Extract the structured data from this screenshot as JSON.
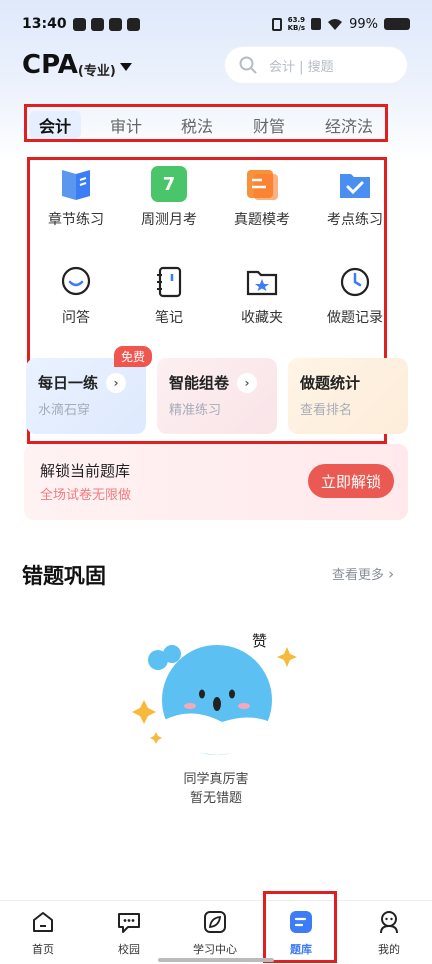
{
  "status_bar": {
    "time": "13:40",
    "net_speed_value": "63.9",
    "net_speed_unit": "KB/s",
    "battery": "99%"
  },
  "header": {
    "exam": "CPA",
    "exam_sub": "(专业)",
    "search_placeholder": "会计 | 搜题"
  },
  "subject_tabs": [
    {
      "label": "会计",
      "active": true
    },
    {
      "label": "审计",
      "active": false
    },
    {
      "label": "税法",
      "active": false
    },
    {
      "label": "财管",
      "active": false
    },
    {
      "label": "经济法",
      "active": false
    }
  ],
  "grid_row1": [
    {
      "label": "章节练习",
      "icon": "book-icon"
    },
    {
      "label": "周测月考",
      "icon": "calendar-icon",
      "icon_text": "7"
    },
    {
      "label": "真题模考",
      "icon": "exam-paper-icon"
    },
    {
      "label": "考点练习",
      "icon": "folder-check-icon"
    }
  ],
  "grid_row2": [
    {
      "label": "问答",
      "icon": "chat-bubble-icon"
    },
    {
      "label": "笔记",
      "icon": "notebook-icon"
    },
    {
      "label": "收藏夹",
      "icon": "star-folder-icon"
    },
    {
      "label": "做题记录",
      "icon": "clock-icon"
    }
  ],
  "cards": [
    {
      "title": "每日一练",
      "subtitle": "水滴石穿",
      "badge": "免费"
    },
    {
      "title": "智能组卷",
      "subtitle": "精准练习"
    },
    {
      "title": "做题统计",
      "subtitle": "查看排名"
    }
  ],
  "unlock": {
    "title": "解锁当前题库",
    "subtitle": "全场试卷无限做",
    "button": "立即解锁"
  },
  "wrong_questions": {
    "title": "错题巩固",
    "more": "查看更多",
    "mascot_text": "赞",
    "empty_line1": "同学真厉害",
    "empty_line2": "暂无错题"
  },
  "bottom_nav": [
    {
      "label": "首页",
      "icon": "home-icon"
    },
    {
      "label": "校园",
      "icon": "chat-icon"
    },
    {
      "label": "学习中心",
      "icon": "leaf-icon"
    },
    {
      "label": "题库",
      "icon": "question-bank-icon",
      "active": true
    },
    {
      "label": "我的",
      "icon": "profile-icon"
    }
  ],
  "colors": {
    "accent_blue": "#3c7cf6",
    "highlight_red": "#e02020",
    "unlock_button": "#ea5a52"
  }
}
